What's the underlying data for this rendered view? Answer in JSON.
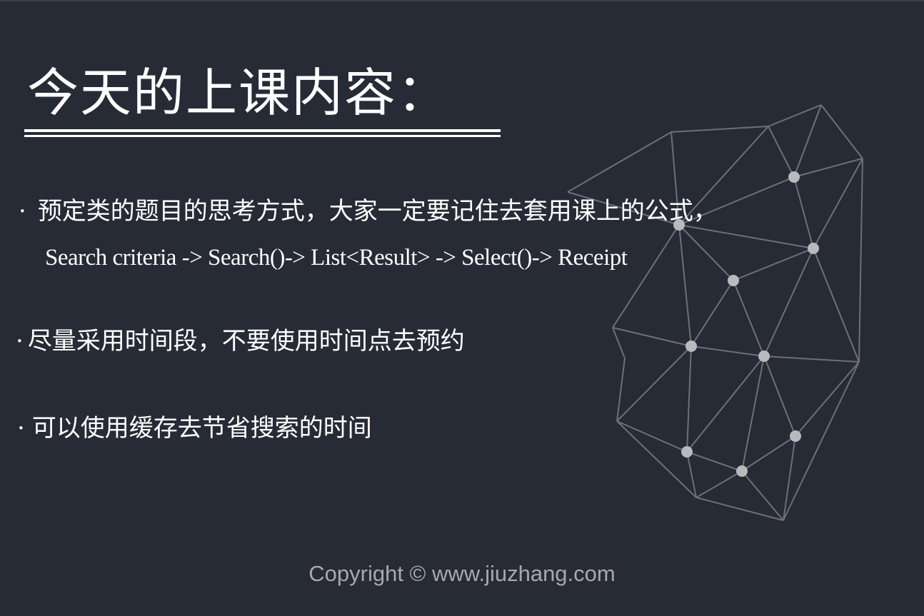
{
  "slide": {
    "title": "今天的上课内容：",
    "bullets": [
      {
        "marker": "·",
        "text": "预定类的题目的思考方式，大家一定要记住去套用课上的公式，",
        "formula": "Search criteria -> Search()-> List<Result> -> Select()-> Receipt"
      },
      {
        "marker": "·",
        "text": "尽量采用时间段，不要使用时间点去预约"
      },
      {
        "marker": "·",
        "text": "可以使用缓存去节省搜索的时间"
      }
    ],
    "copyright": "Copyright © www.jiuzhang.com"
  },
  "colors": {
    "background": "#262b36",
    "text": "#ffffff",
    "network_line": "#6d7078",
    "network_node": "#b9babd",
    "copyright": "#a6a8ad"
  }
}
